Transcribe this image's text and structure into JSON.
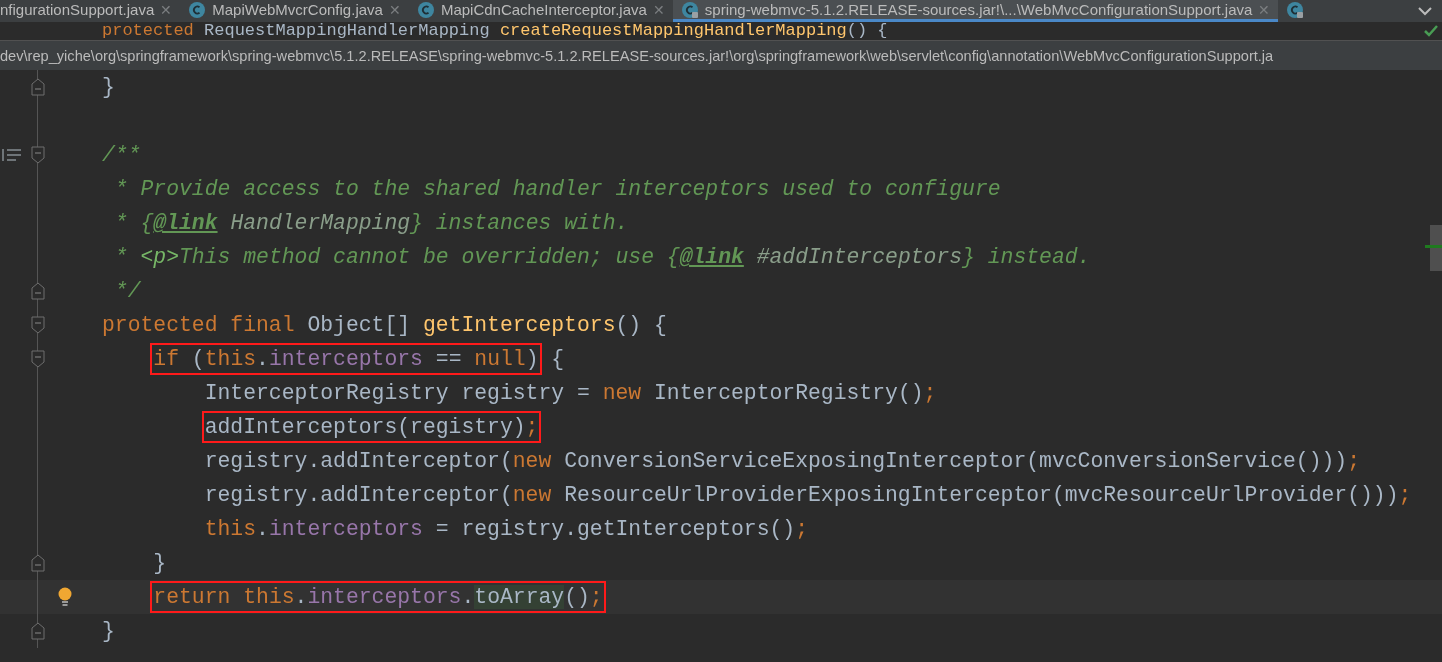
{
  "tabs": [
    {
      "label": "nfigurationSupport.java",
      "close": "✕",
      "icon": false,
      "selected": false
    },
    {
      "label": "MapiWebMvcrConfig.java",
      "close": "✕",
      "icon": true,
      "locked": false,
      "selected": false
    },
    {
      "label": "MapiCdnCacheInterceptor.java",
      "close": "✕",
      "icon": true,
      "locked": false,
      "selected": false
    },
    {
      "label": "spring-webmvc-5.1.2.RELEASE-sources.jar!\\...\\WebMvcConfigurationSupport.java",
      "close": "✕",
      "icon": true,
      "locked": true,
      "selected": true
    },
    {
      "icon": true,
      "locked": true,
      "selected": false
    }
  ],
  "hidden_line": [
    {
      "t": "protected ",
      "kind": "kw"
    },
    {
      "t": "RequestMappingHandlerMapping ",
      "kind": "plain"
    },
    {
      "t": "createRequestMappingHandlerMapping",
      "kind": "decl"
    },
    {
      "t": "() {",
      "kind": "plain"
    }
  ],
  "breadcrumb": "dev\\rep_yiche\\org\\springframework\\spring-webmvc\\5.1.2.RELEASE\\spring-webmvc-5.1.2.RELEASE-sources.jar!\\org\\springframework\\web\\servlet\\config\\annotation\\WebMvcConfigurationSupport.ja",
  "lines": [
    {
      "kind": "fold-end",
      "current": false,
      "segments": [
        {
          "boxed": false,
          "tokens": [
            {
              "t": "}",
              "kind": "plain"
            }
          ]
        }
      ]
    },
    {
      "kind": "blank",
      "current": false
    },
    {
      "kind": "doc-start",
      "current": false,
      "segments": [
        {
          "boxed": false,
          "tokens": [
            {
              "t": "/**",
              "kind": "comment"
            }
          ]
        }
      ]
    },
    {
      "kind": "plain",
      "current": false,
      "segments": [
        {
          "boxed": false,
          "tokens": [
            {
              "t": " * Provide access to the shared handler interceptors used to configure",
              "kind": "comment"
            }
          ]
        }
      ]
    },
    {
      "kind": "plain",
      "current": false,
      "segments": [
        {
          "boxed": false,
          "tokens": [
            {
              "t": " * {",
              "kind": "comment"
            },
            {
              "t": "@link",
              "kind": "doctag"
            },
            {
              "t": " HandlerMapping",
              "kind": "docref"
            },
            {
              "t": "} instances with.",
              "kind": "comment"
            }
          ]
        }
      ]
    },
    {
      "kind": "plain",
      "current": false,
      "segments": [
        {
          "boxed": false,
          "tokens": [
            {
              "t": " * ",
              "kind": "comment"
            },
            {
              "t": "<p>",
              "kind": "docmarkup"
            },
            {
              "t": "This method cannot be overridden; use {",
              "kind": "comment"
            },
            {
              "t": "@link",
              "kind": "doctag"
            },
            {
              "t": " #addInterceptors",
              "kind": "docref"
            },
            {
              "t": "} instead.",
              "kind": "comment"
            }
          ]
        }
      ]
    },
    {
      "kind": "fold-end",
      "current": false,
      "segments": [
        {
          "boxed": false,
          "tokens": [
            {
              "t": " */",
              "kind": "comment"
            }
          ]
        }
      ]
    },
    {
      "kind": "fold-start",
      "current": false,
      "segments": [
        {
          "boxed": false,
          "tokens": [
            {
              "t": "protected final ",
              "kind": "kw"
            },
            {
              "t": "Object[] ",
              "kind": "plain"
            },
            {
              "t": "getInterceptors",
              "kind": "decl"
            },
            {
              "t": "() {",
              "kind": "plain"
            }
          ]
        }
      ],
      "children": [
        {
          "kind": "fold-start",
          "current": false,
          "segments": [
            {
              "boxed": true,
              "tokens": [
                {
                  "t": "if ",
                  "kind": "kw"
                },
                {
                  "t": "(",
                  "kind": "plain"
                },
                {
                  "t": "this",
                  "kind": "kw"
                },
                {
                  "t": ".",
                  "kind": "plain"
                },
                {
                  "t": "interceptors",
                  "kind": "field"
                },
                {
                  "t": " == ",
                  "kind": "plain"
                },
                {
                  "t": "null",
                  "kind": "kw"
                },
                {
                  "t": ")",
                  "kind": "plain"
                }
              ]
            },
            {
              "boxed": false,
              "tokens": [
                {
                  "t": " {",
                  "kind": "plain"
                }
              ]
            }
          ],
          "children": [
            {
              "kind": "plain",
              "current": false,
              "segments": [
                {
                  "boxed": false,
                  "tokens": [
                    {
                      "t": "InterceptorRegistry registry = ",
                      "kind": "plain"
                    },
                    {
                      "t": "new ",
                      "kind": "kw"
                    },
                    {
                      "t": "InterceptorRegistry()",
                      "kind": "plain"
                    },
                    {
                      "t": ";",
                      "kind": "kw"
                    }
                  ]
                }
              ]
            },
            {
              "kind": "plain",
              "current": false,
              "segments": [
                {
                  "boxed": true,
                  "tokens": [
                    {
                      "t": "addInterceptors(registry)",
                      "kind": "plain"
                    },
                    {
                      "t": ";",
                      "kind": "kw"
                    }
                  ]
                }
              ]
            },
            {
              "kind": "plain",
              "current": false,
              "segments": [
                {
                  "boxed": false,
                  "tokens": [
                    {
                      "t": "registry.addInterceptor(",
                      "kind": "plain"
                    },
                    {
                      "t": "new ",
                      "kind": "kw"
                    },
                    {
                      "t": "ConversionServiceExposingInterceptor(mvcConversionService()))",
                      "kind": "plain"
                    },
                    {
                      "t": ";",
                      "kind": "kw"
                    }
                  ]
                }
              ]
            },
            {
              "kind": "plain",
              "current": false,
              "segments": [
                {
                  "boxed": false,
                  "tokens": [
                    {
                      "t": "registry.addInterceptor(",
                      "kind": "plain"
                    },
                    {
                      "t": "new ",
                      "kind": "kw"
                    },
                    {
                      "t": "ResourceUrlProviderExposingInterceptor(mvcResourceUrlProvider()))",
                      "kind": "plain"
                    },
                    {
                      "t": ";",
                      "kind": "kw"
                    }
                  ]
                }
              ]
            },
            {
              "kind": "plain",
              "current": false,
              "segments": [
                {
                  "boxed": false,
                  "tokens": [
                    {
                      "t": "this",
                      "kind": "kw"
                    },
                    {
                      "t": ".",
                      "kind": "plain"
                    },
                    {
                      "t": "interceptors",
                      "kind": "field"
                    },
                    {
                      "t": " = registry.getInterceptors()",
                      "kind": "plain"
                    },
                    {
                      "t": ";",
                      "kind": "kw"
                    }
                  ]
                }
              ]
            }
          ]
        },
        {
          "kind": "fold-end",
          "current": false,
          "segments": [
            {
              "boxed": false,
              "tokens": [
                {
                  "t": "}",
                  "kind": "plain"
                }
              ]
            }
          ]
        },
        {
          "kind": "plain",
          "current": true,
          "segments": [
            {
              "boxed": true,
              "tokens": [
                {
                  "t": "return ",
                  "kind": "kw"
                },
                {
                  "t": "this",
                  "kind": "kw"
                },
                {
                  "t": ".",
                  "kind": "plain"
                },
                {
                  "t": "interceptors",
                  "kind": "field"
                },
                {
                  "t": ".",
                  "kind": "plain"
                },
                {
                  "t": "toArray",
                  "kind": "hl"
                },
                {
                  "t": "()",
                  "kind": "plain"
                },
                {
                  "t": ";",
                  "kind": "kw"
                }
              ]
            }
          ]
        }
      ]
    },
    {
      "kind": "fold-end",
      "current": false,
      "segments": [
        {
          "boxed": false,
          "tokens": [
            {
              "t": "}",
              "kind": "plain"
            }
          ]
        }
      ]
    }
  ]
}
